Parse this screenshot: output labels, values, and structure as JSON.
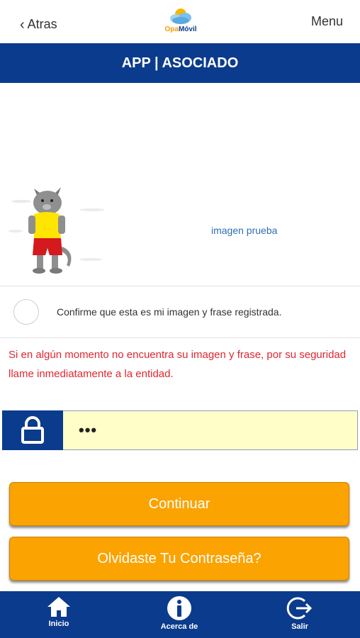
{
  "header": {
    "back_label": "Atras",
    "logo": {
      "part1": "Opa",
      "part2": "Móvil"
    },
    "menu_label": "Menu"
  },
  "title": "APP | ASOCIADO",
  "security_image": {
    "caption": "imagen prueba",
    "image_icon": "cat-cartoon"
  },
  "confirm": {
    "label": "Confirme que esta es mi imagen y frase registrada.",
    "checked": false
  },
  "warning": "Si en algún momento no encuentra su imagen y frase, por su seguridad llame inmediatamente a la entidad.",
  "password": {
    "icon": "lock-icon",
    "value": "•••"
  },
  "buttons": {
    "continue": "Continuar",
    "forgot": "Olvidaste Tu Contraseña?"
  },
  "bottom_nav": [
    {
      "label": "Inicio",
      "icon": "home-icon"
    },
    {
      "label": "Acerca de",
      "icon": "info-icon"
    },
    {
      "label": "Salir",
      "icon": "logout-icon"
    }
  ],
  "colors": {
    "brand_blue": "#0b3b8c",
    "button_orange": "#fba300",
    "warning_red": "#e0262f",
    "input_yellow": "#fffec8",
    "link_blue": "#2f6db5"
  }
}
